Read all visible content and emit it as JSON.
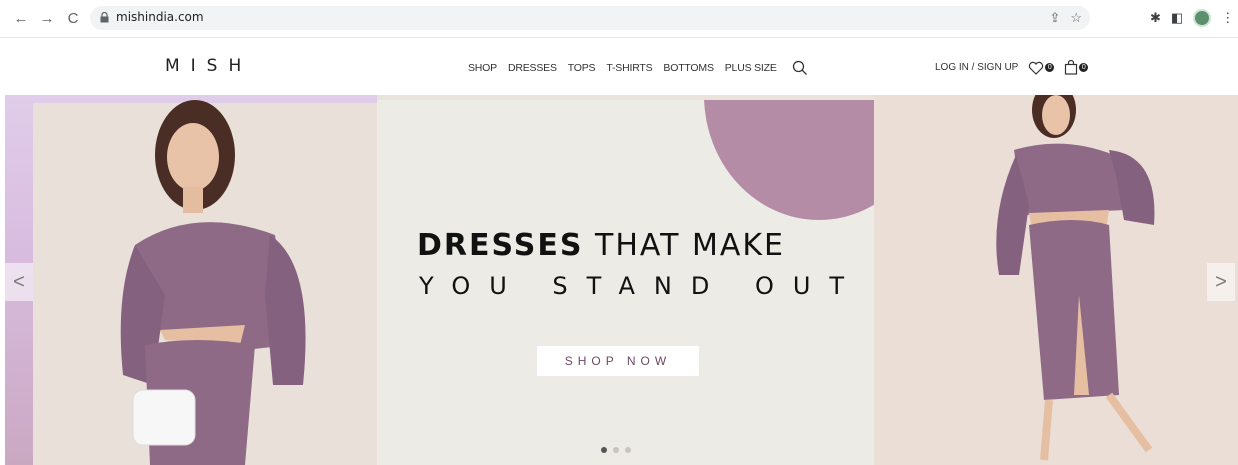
{
  "browser": {
    "nav_back": "←",
    "nav_forward": "→",
    "nav_reload": "C",
    "url": "mishindia.com"
  },
  "header": {
    "logo": "MISH",
    "nav": [
      "SHOP",
      "DRESSES",
      "TOPS",
      "T-SHIRTS",
      "BOTTOMS",
      "PLUS SIZE"
    ],
    "account_link": "LOG IN / SIGN UP",
    "wishlist_count": "0",
    "cart_count": "0"
  },
  "hero": {
    "headline_bold": "DRESSES",
    "headline_rest": " THAT MAKE",
    "headline_line2": "YOU STAND OUT",
    "cta": "SHOP NOW",
    "prev_arrow": "<",
    "next_arrow": ">",
    "slides": 3,
    "active_slide": 1
  },
  "colors": {
    "accent_mauve": "#b48ca6",
    "dress": "#8e6a86",
    "background_beige": "#ecebe5"
  },
  "icons": [
    "search-icon",
    "heart-icon",
    "bag-icon",
    "lock-icon",
    "share-icon",
    "star-icon",
    "extension-icon",
    "sidepanel-icon",
    "profile-icon"
  ]
}
